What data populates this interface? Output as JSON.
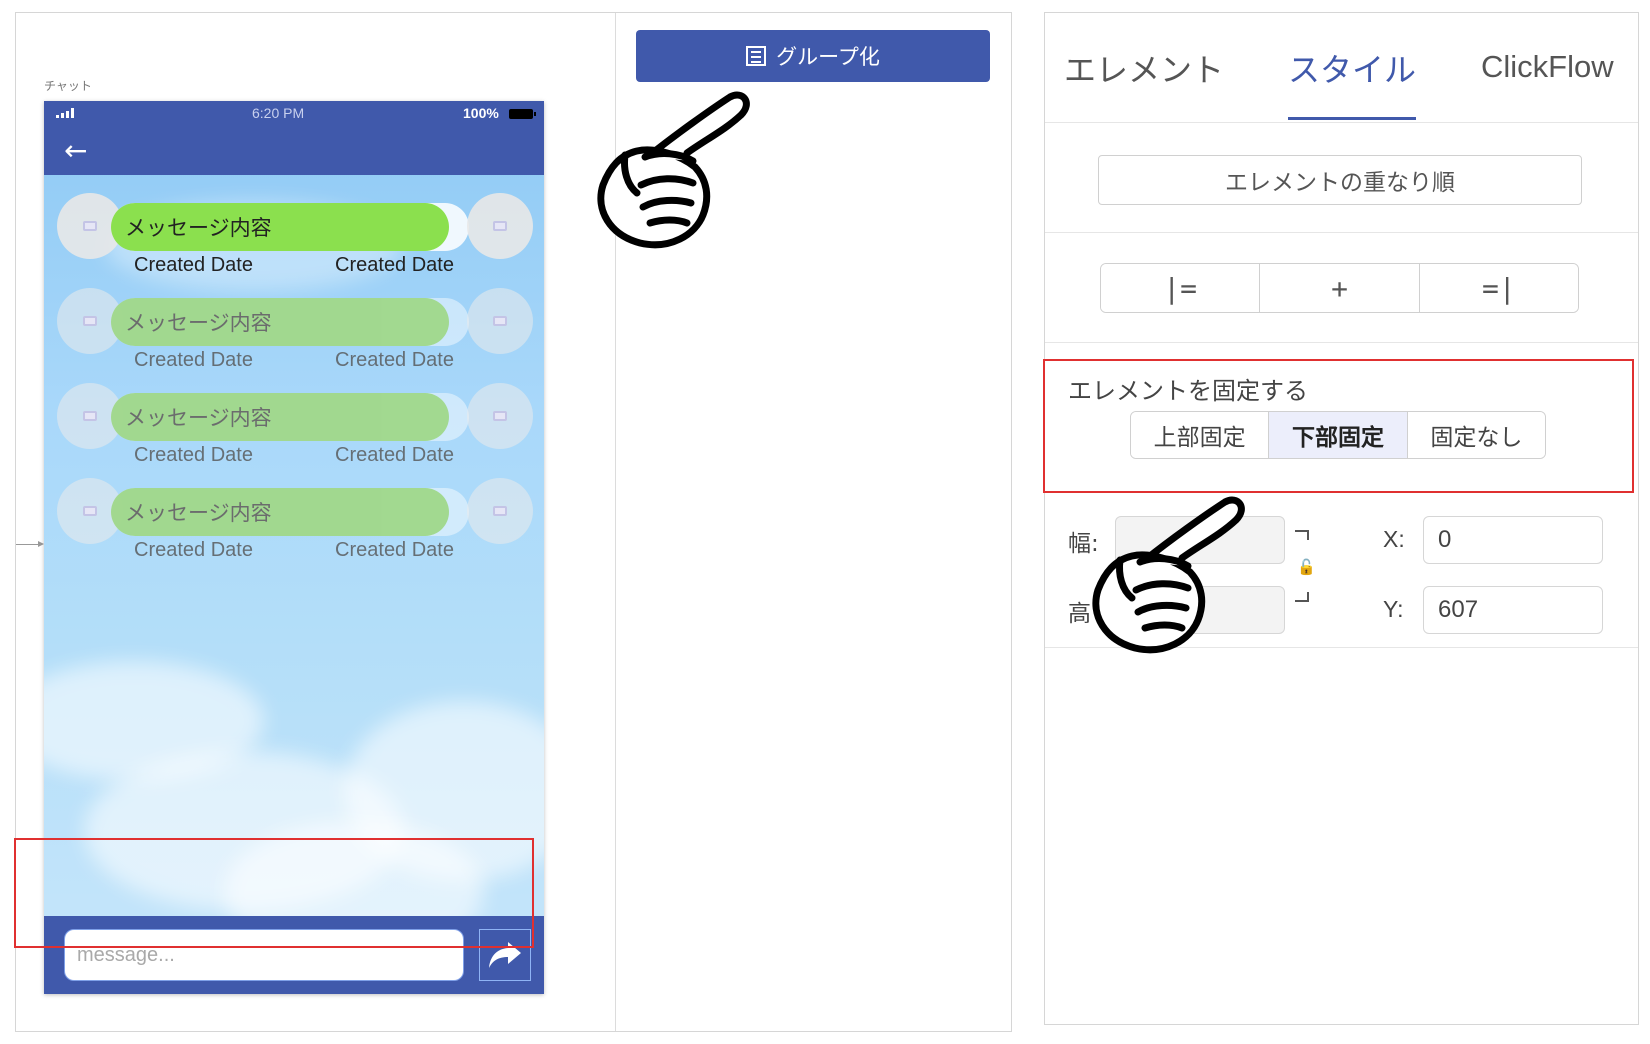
{
  "canvas": {
    "screen_caption": "チャット",
    "status_bar": {
      "time": "6:20 PM",
      "battery": "100%"
    },
    "header": {
      "back_icon": "arrow-left-icon"
    },
    "messages": [
      {
        "text": "メッセージ内容",
        "date_left": "Created Date",
        "date_right": "Created Date"
      },
      {
        "text": "メッセージ内容",
        "date_left": "Created Date",
        "date_right": "Created Date"
      },
      {
        "text": "メッセージ内容",
        "date_left": "Created Date",
        "date_right": "Created Date"
      },
      {
        "text": "メッセージ内容",
        "date_left": "Created Date",
        "date_right": "Created Date"
      }
    ],
    "input": {
      "placeholder": "message..."
    },
    "send_icon": "share-arrow-icon",
    "group_button": "グループ化"
  },
  "properties": {
    "tabs": [
      {
        "label": "エレメント"
      },
      {
        "label": "スタイル",
        "active": true
      },
      {
        "label": "ClickFlow"
      }
    ],
    "z_order_button": "エレメントの重なり順",
    "align_buttons": [
      "|=",
      "+",
      "=|"
    ],
    "fix_section": {
      "title": "エレメントを固定する",
      "options": [
        "上部固定",
        "下部固定",
        "固定なし"
      ],
      "selected": "下部固定"
    },
    "dimensions": {
      "width_label": "幅:",
      "height_label": "高",
      "x_label": "X:",
      "x_value": "0",
      "y_label": "Y:",
      "y_value": "607"
    }
  },
  "colors": {
    "primary": "#4059ab",
    "bubble_green": "#8be04e",
    "highlight_red": "#e03030"
  }
}
